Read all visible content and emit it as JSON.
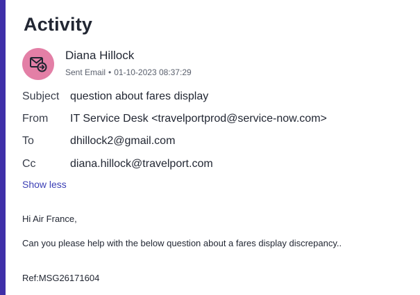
{
  "header": {
    "title": "Activity"
  },
  "email": {
    "sender_name": "Diana Hillock",
    "status": "Sent Email",
    "timestamp": "01-10-2023 08:37:29",
    "fields": {
      "subject_label": "Subject",
      "subject_value": "question about fares display",
      "from_label": "From",
      "from_value": "IT Service Desk <travelportprod@service-now.com>",
      "to_label": "To",
      "to_value": "dhillock2@gmail.com",
      "cc_label": "Cc",
      "cc_value": "diana.hillock@travelport.com"
    },
    "toggle_label": "Show less",
    "body": {
      "greeting": "Hi Air France,",
      "message": "Can you please help with the below question about a fares display discrepancy..",
      "reference": "Ref:MSG26171604"
    }
  },
  "icons": {
    "avatar": "sent-email-icon"
  },
  "colors": {
    "accent_bar": "#3f2fa8",
    "avatar_bg": "#e37fa6",
    "link": "#3b3fb5"
  }
}
